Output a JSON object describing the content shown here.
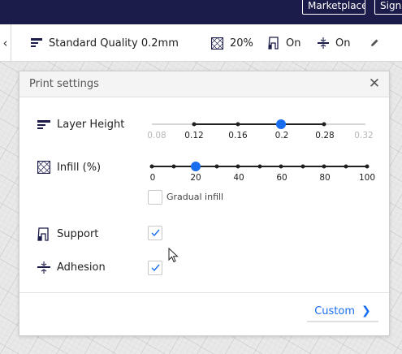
{
  "topbar": {
    "marketplace_label": "Marketplace",
    "signin_label": "Sign"
  },
  "header": {
    "profile_label": "Standard Quality 0.2mm",
    "infill_value": "20%",
    "support_value": "On",
    "adhesion_value": "On"
  },
  "panel": {
    "title": "Print settings",
    "layer_height": {
      "label": "Layer Height",
      "ticks": [
        "0.08",
        "0.12",
        "0.16",
        "0.2",
        "0.28",
        "0.32"
      ],
      "selected": "0.2"
    },
    "infill": {
      "label": "Infill (%)",
      "ticks": [
        "0",
        "20",
        "40",
        "60",
        "80",
        "100"
      ],
      "selected_percent": 20,
      "gradual_label": "Gradual infill",
      "gradual_checked": false
    },
    "support": {
      "label": "Support",
      "checked": true
    },
    "adhesion": {
      "label": "Adhesion",
      "checked": true
    },
    "custom_button": "Custom"
  },
  "colors": {
    "accent": "#196ef0",
    "topbar": "#1c1c4b"
  }
}
